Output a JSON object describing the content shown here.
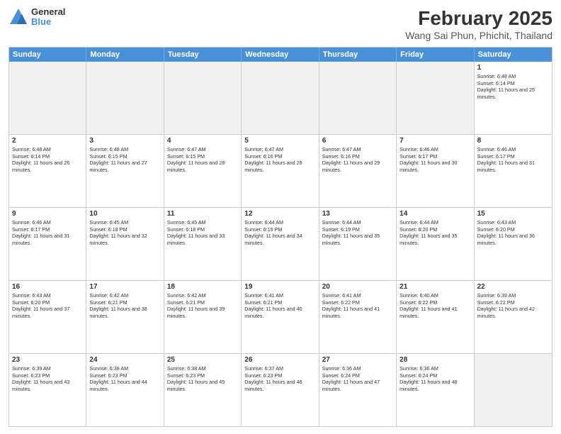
{
  "logo": {
    "general": "General",
    "blue": "Blue"
  },
  "title": "February 2025",
  "subtitle": "Wang Sai Phun, Phichit, Thailand",
  "header_days": [
    "Sunday",
    "Monday",
    "Tuesday",
    "Wednesday",
    "Thursday",
    "Friday",
    "Saturday"
  ],
  "weeks": [
    [
      {
        "day": "",
        "text": "",
        "shaded": true
      },
      {
        "day": "",
        "text": "",
        "shaded": true
      },
      {
        "day": "",
        "text": "",
        "shaded": true
      },
      {
        "day": "",
        "text": "",
        "shaded": true
      },
      {
        "day": "",
        "text": "",
        "shaded": true
      },
      {
        "day": "",
        "text": "",
        "shaded": true
      },
      {
        "day": "1",
        "text": "Sunrise: 6:48 AM\nSunset: 6:14 PM\nDaylight: 11 hours and 25 minutes.",
        "shaded": false
      }
    ],
    [
      {
        "day": "2",
        "text": "Sunrise: 6:48 AM\nSunset: 6:14 PM\nDaylight: 11 hours and 26 minutes.",
        "shaded": false
      },
      {
        "day": "3",
        "text": "Sunrise: 6:48 AM\nSunset: 6:15 PM\nDaylight: 11 hours and 27 minutes.",
        "shaded": false
      },
      {
        "day": "4",
        "text": "Sunrise: 6:47 AM\nSunset: 6:15 PM\nDaylight: 11 hours and 28 minutes.",
        "shaded": false
      },
      {
        "day": "5",
        "text": "Sunrise: 6:47 AM\nSunset: 6:16 PM\nDaylight: 11 hours and 28 minutes.",
        "shaded": false
      },
      {
        "day": "6",
        "text": "Sunrise: 6:47 AM\nSunset: 6:16 PM\nDaylight: 11 hours and 29 minutes.",
        "shaded": false
      },
      {
        "day": "7",
        "text": "Sunrise: 6:46 AM\nSunset: 6:17 PM\nDaylight: 11 hours and 30 minutes.",
        "shaded": false
      },
      {
        "day": "8",
        "text": "Sunrise: 6:46 AM\nSunset: 6:17 PM\nDaylight: 11 hours and 31 minutes.",
        "shaded": false
      }
    ],
    [
      {
        "day": "9",
        "text": "Sunrise: 6:46 AM\nSunset: 6:17 PM\nDaylight: 11 hours and 31 minutes.",
        "shaded": false
      },
      {
        "day": "10",
        "text": "Sunrise: 6:45 AM\nSunset: 6:18 PM\nDaylight: 11 hours and 32 minutes.",
        "shaded": false
      },
      {
        "day": "11",
        "text": "Sunrise: 6:45 AM\nSunset: 6:18 PM\nDaylight: 11 hours and 33 minutes.",
        "shaded": false
      },
      {
        "day": "12",
        "text": "Sunrise: 6:44 AM\nSunset: 6:19 PM\nDaylight: 11 hours and 34 minutes.",
        "shaded": false
      },
      {
        "day": "13",
        "text": "Sunrise: 6:44 AM\nSunset: 6:19 PM\nDaylight: 11 hours and 35 minutes.",
        "shaded": false
      },
      {
        "day": "14",
        "text": "Sunrise: 6:44 AM\nSunset: 6:20 PM\nDaylight: 11 hours and 35 minutes.",
        "shaded": false
      },
      {
        "day": "15",
        "text": "Sunrise: 6:43 AM\nSunset: 6:20 PM\nDaylight: 11 hours and 36 minutes.",
        "shaded": false
      }
    ],
    [
      {
        "day": "16",
        "text": "Sunrise: 6:43 AM\nSunset: 6:20 PM\nDaylight: 11 hours and 37 minutes.",
        "shaded": false
      },
      {
        "day": "17",
        "text": "Sunrise: 6:42 AM\nSunset: 6:21 PM\nDaylight: 11 hours and 38 minutes.",
        "shaded": false
      },
      {
        "day": "18",
        "text": "Sunrise: 6:42 AM\nSunset: 6:21 PM\nDaylight: 11 hours and 39 minutes.",
        "shaded": false
      },
      {
        "day": "19",
        "text": "Sunrise: 6:41 AM\nSunset: 6:21 PM\nDaylight: 11 hours and 40 minutes.",
        "shaded": false
      },
      {
        "day": "20",
        "text": "Sunrise: 6:41 AM\nSunset: 6:22 PM\nDaylight: 11 hours and 41 minutes.",
        "shaded": false
      },
      {
        "day": "21",
        "text": "Sunrise: 6:40 AM\nSunset: 6:22 PM\nDaylight: 11 hours and 41 minutes.",
        "shaded": false
      },
      {
        "day": "22",
        "text": "Sunrise: 6:39 AM\nSunset: 6:22 PM\nDaylight: 11 hours and 42 minutes.",
        "shaded": false
      }
    ],
    [
      {
        "day": "23",
        "text": "Sunrise: 6:39 AM\nSunset: 6:23 PM\nDaylight: 11 hours and 43 minutes.",
        "shaded": false
      },
      {
        "day": "24",
        "text": "Sunrise: 6:38 AM\nSunset: 6:23 PM\nDaylight: 11 hours and 44 minutes.",
        "shaded": false
      },
      {
        "day": "25",
        "text": "Sunrise: 6:38 AM\nSunset: 6:23 PM\nDaylight: 11 hours and 45 minutes.",
        "shaded": false
      },
      {
        "day": "26",
        "text": "Sunrise: 6:37 AM\nSunset: 6:23 PM\nDaylight: 11 hours and 46 minutes.",
        "shaded": false
      },
      {
        "day": "27",
        "text": "Sunrise: 6:36 AM\nSunset: 6:24 PM\nDaylight: 11 hours and 47 minutes.",
        "shaded": false
      },
      {
        "day": "28",
        "text": "Sunrise: 6:36 AM\nSunset: 6:24 PM\nDaylight: 11 hours and 48 minutes.",
        "shaded": false
      },
      {
        "day": "",
        "text": "",
        "shaded": true
      }
    ]
  ]
}
